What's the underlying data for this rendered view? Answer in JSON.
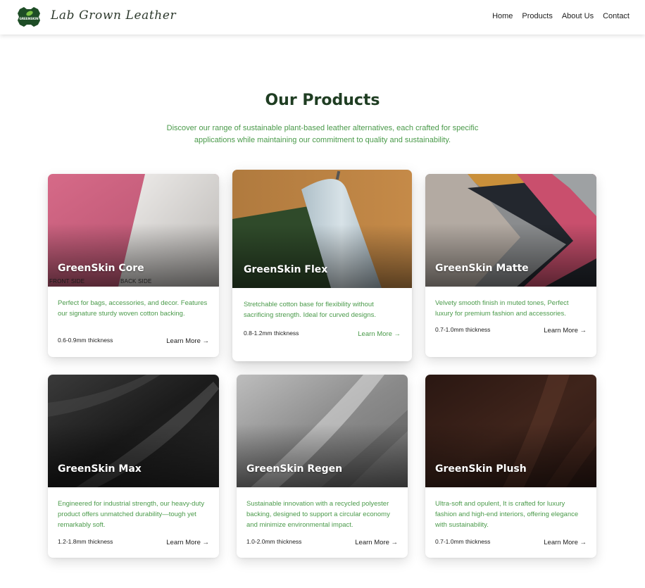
{
  "header": {
    "brand": "Lab Grown Leather",
    "logo_text": "GREENSKIN",
    "nav": [
      "Home",
      "Products",
      "About Us",
      "Contact"
    ]
  },
  "section": {
    "title": "Our Products",
    "subtitle": "Discover our range of sustainable plant-based leather alternatives, each crafted for specific applications while maintaining our commitment to quality and sustainability."
  },
  "products": [
    {
      "name": "GreenSkin Core",
      "description": "Perfect for bags, accessories, and decor. Features our signature sturdy woven cotton backing.",
      "thickness": "0.6-0.9mm thickness",
      "cta": "Learn More →",
      "image_labels": [
        "FRONT SIDE",
        "BACK SIDE"
      ]
    },
    {
      "name": "GreenSkin Flex",
      "description": "Stretchable cotton base for flexibility without sacrificing strength. Ideal for curved designs.",
      "thickness": "0.8-1.2mm thickness",
      "cta": "Learn More →"
    },
    {
      "name": "GreenSkin Matte",
      "description": "Velvety smooth finish in muted tones, Perfect luxury for premium fashion and accessories.",
      "thickness": "0.7-1.0mm thickness",
      "cta": "Learn More →"
    },
    {
      "name": "GreenSkin Max",
      "description": "Engineered for industrial strength, our heavy-duty product offers unmatched durability—tough yet remarkably soft.",
      "thickness": "1.2-1.8mm thickness",
      "cta": "Learn More →"
    },
    {
      "name": "GreenSkin Regen",
      "description": "Sustainable innovation with a recycled polyester backing, designed to support a circular economy and minimize environmental impact.",
      "thickness": "1.0-2.0mm thickness",
      "cta": "Learn More →"
    },
    {
      "name": "GreenSkin Plush",
      "description": "Ultra-soft and opulent, It is crafted for luxury fashion and high-end interiors, offering elegance with sustainability.",
      "thickness": "0.7-1.0mm thickness",
      "cta": "Learn More →"
    }
  ],
  "colors": {
    "heading": "#1f3d22",
    "accent_green": "#4a9a4a",
    "logo_green": "#1f5a2a"
  }
}
